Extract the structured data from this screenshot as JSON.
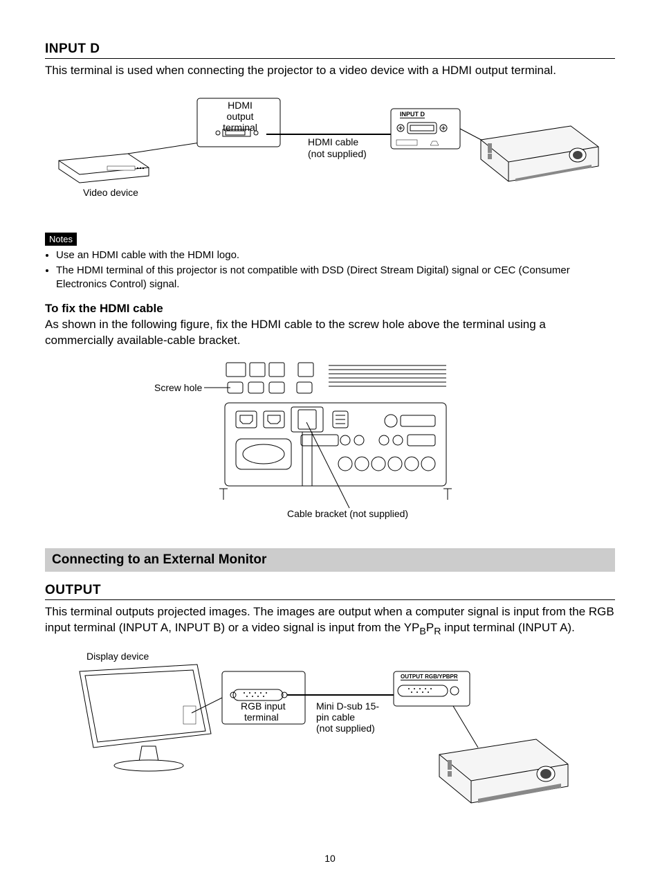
{
  "inputD": {
    "title": "INPUT D",
    "intro": "This terminal is used when connecting the projector to a video device with a HDMI output terminal.",
    "fig1": {
      "hdmi_output": "HDMI output terminal",
      "hdmi_cable_l1": "HDMI cable",
      "hdmi_cable_l2": "(not supplied)",
      "video_device": "Video device",
      "input_d_label": "INPUT D"
    },
    "notes_heading": "Notes",
    "notes": [
      "Use an HDMI cable with the HDMI logo.",
      "The HDMI terminal of this projector is not compatible with DSD (Direct Stream Digital) signal or CEC (Consumer Electronics Control) signal."
    ],
    "fix_heading": "To fix the HDMI cable",
    "fix_body": "As shown in the following figure, fix the HDMI cable to the screw hole above the terminal using a commercially available-cable bracket.",
    "fig2": {
      "screw_hole": "Screw hole",
      "cable_bracket": "Cable bracket (not supplied)"
    }
  },
  "banner": "Connecting to an External Monitor",
  "output": {
    "title": "OUTPUT",
    "intro_pre": "This terminal outputs projected images. The images are output when a computer signal is input from the RGB input terminal (INPUT A, INPUT B) or a video signal is input from the YP",
    "intro_sub1": "B",
    "intro_mid": "P",
    "intro_sub2": "R",
    "intro_post": " input terminal (INPUT A).",
    "fig3": {
      "display_device": "Display device",
      "rgb_input_l1": "RGB input",
      "rgb_input_l2": "terminal",
      "mini_dsub_l1": "Mini D-sub 15-",
      "mini_dsub_l2": "pin cable",
      "mini_dsub_l3": "(not supplied)",
      "output_label": "OUTPUT RGB/YPBPR"
    }
  },
  "page_number": "10"
}
